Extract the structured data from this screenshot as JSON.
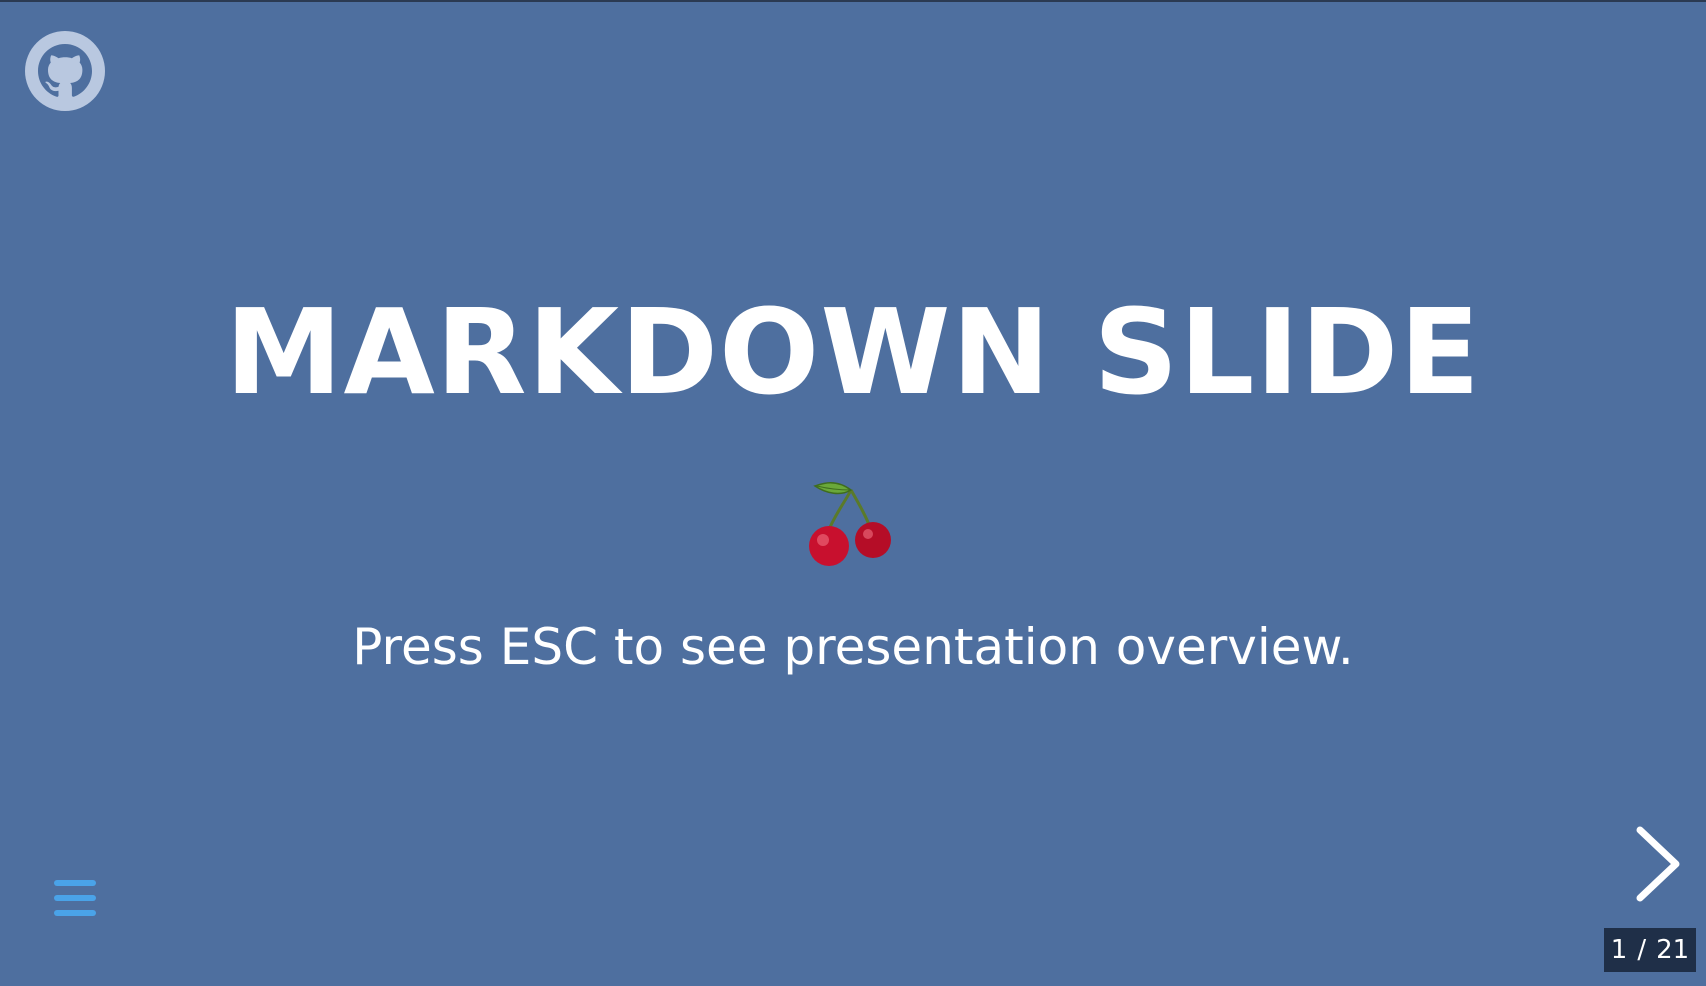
{
  "slide": {
    "title": "MARKDOWN SLIDE",
    "emoji": "cherries",
    "subtitle": "Press ESC to see presentation overview."
  },
  "controls": {
    "github_icon": "github-icon",
    "menu_icon": "hamburger-menu-icon",
    "next_icon": "chevron-right-icon",
    "menu_color": "#4aa3e8"
  },
  "progress": {
    "current": "1",
    "separator": "/",
    "total": "21"
  },
  "colors": {
    "background": "#4e6f9f",
    "text": "#ffffff",
    "counter_bg": "#1f2f48"
  }
}
